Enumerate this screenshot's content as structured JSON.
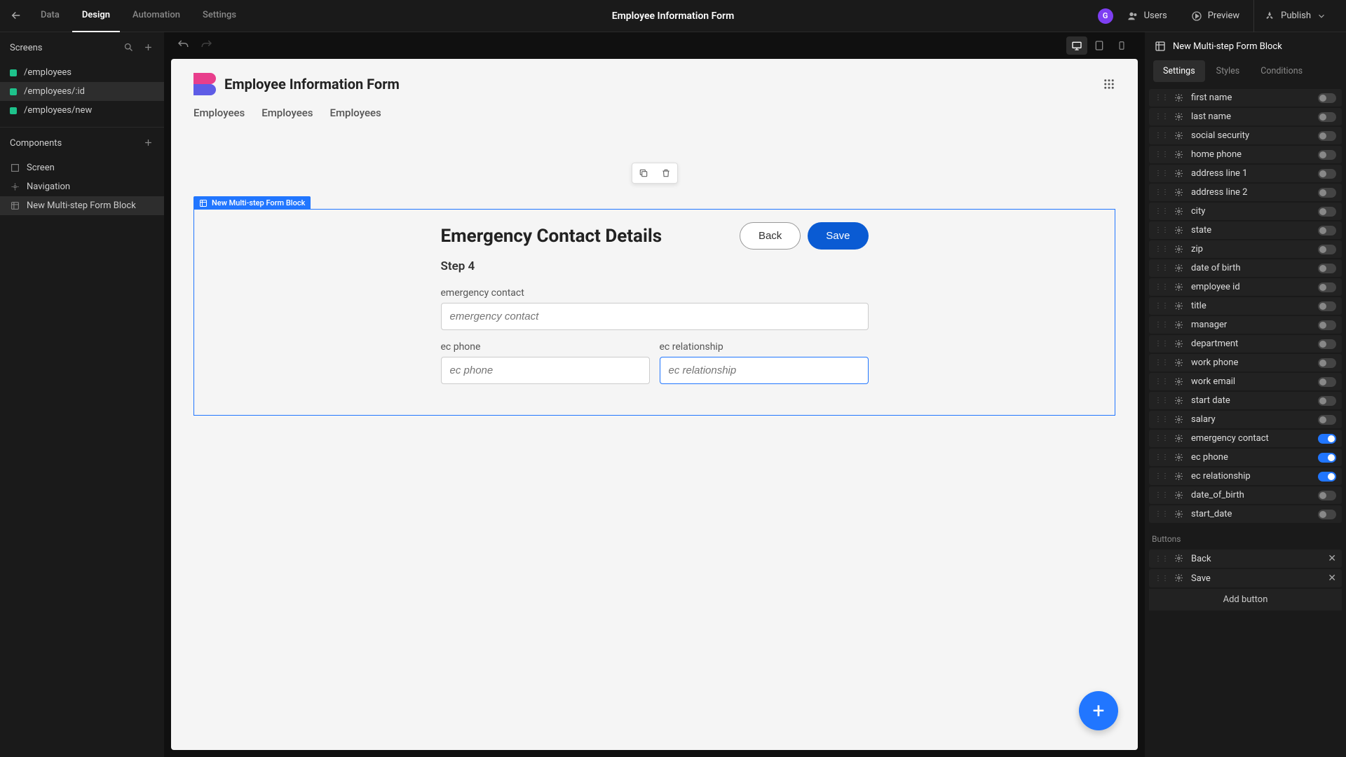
{
  "topbar": {
    "tabs": [
      "Data",
      "Design",
      "Automation",
      "Settings"
    ],
    "active_tab_index": 1,
    "title": "Employee Information Form",
    "avatar_letter": "G",
    "actions": {
      "users": "Users",
      "preview": "Preview",
      "publish": "Publish"
    }
  },
  "left": {
    "screens_label": "Screens",
    "screens": [
      "/employees",
      "/employees/:id",
      "/employees/new"
    ],
    "screen_selected_index": 1,
    "components_label": "Components",
    "components": [
      "Screen",
      "Navigation",
      "New Multi-step Form Block"
    ],
    "component_selected_index": 2
  },
  "canvas": {
    "app_title": "Employee Information Form",
    "tabs": [
      "Employees",
      "Employees",
      "Employees"
    ],
    "form_tag": "New Multi-step Form Block",
    "form_title": "Emergency Contact Details",
    "back_label": "Back",
    "save_label": "Save",
    "step": "Step 4",
    "fields": {
      "ec": {
        "label": "emergency contact",
        "placeholder": "emergency contact"
      },
      "phone": {
        "label": "ec phone",
        "placeholder": "ec phone"
      },
      "rel": {
        "label": "ec relationship",
        "placeholder": "ec relationship"
      }
    }
  },
  "right": {
    "title": "New Multi-step Form Block",
    "tabs": [
      "Settings",
      "Styles",
      "Conditions"
    ],
    "active_tab_index": 0,
    "fields": [
      {
        "label": "first name",
        "on": false
      },
      {
        "label": "last name",
        "on": false
      },
      {
        "label": "social security",
        "on": false
      },
      {
        "label": "home phone",
        "on": false
      },
      {
        "label": "address line 1",
        "on": false
      },
      {
        "label": "address line 2",
        "on": false
      },
      {
        "label": "city",
        "on": false
      },
      {
        "label": "state",
        "on": false
      },
      {
        "label": "zip",
        "on": false
      },
      {
        "label": "date of birth",
        "on": false
      },
      {
        "label": "employee id",
        "on": false
      },
      {
        "label": "title",
        "on": false
      },
      {
        "label": "manager",
        "on": false
      },
      {
        "label": "department",
        "on": false
      },
      {
        "label": "work phone",
        "on": false
      },
      {
        "label": "work email",
        "on": false
      },
      {
        "label": "start date",
        "on": false
      },
      {
        "label": "salary",
        "on": false
      },
      {
        "label": "emergency contact",
        "on": true
      },
      {
        "label": "ec phone",
        "on": true
      },
      {
        "label": "ec relationship",
        "on": true
      },
      {
        "label": "date_of_birth",
        "on": false
      },
      {
        "label": "start_date",
        "on": false
      }
    ],
    "buttons_label": "Buttons",
    "buttons": [
      "Back",
      "Save"
    ],
    "add_button_label": "Add button"
  }
}
